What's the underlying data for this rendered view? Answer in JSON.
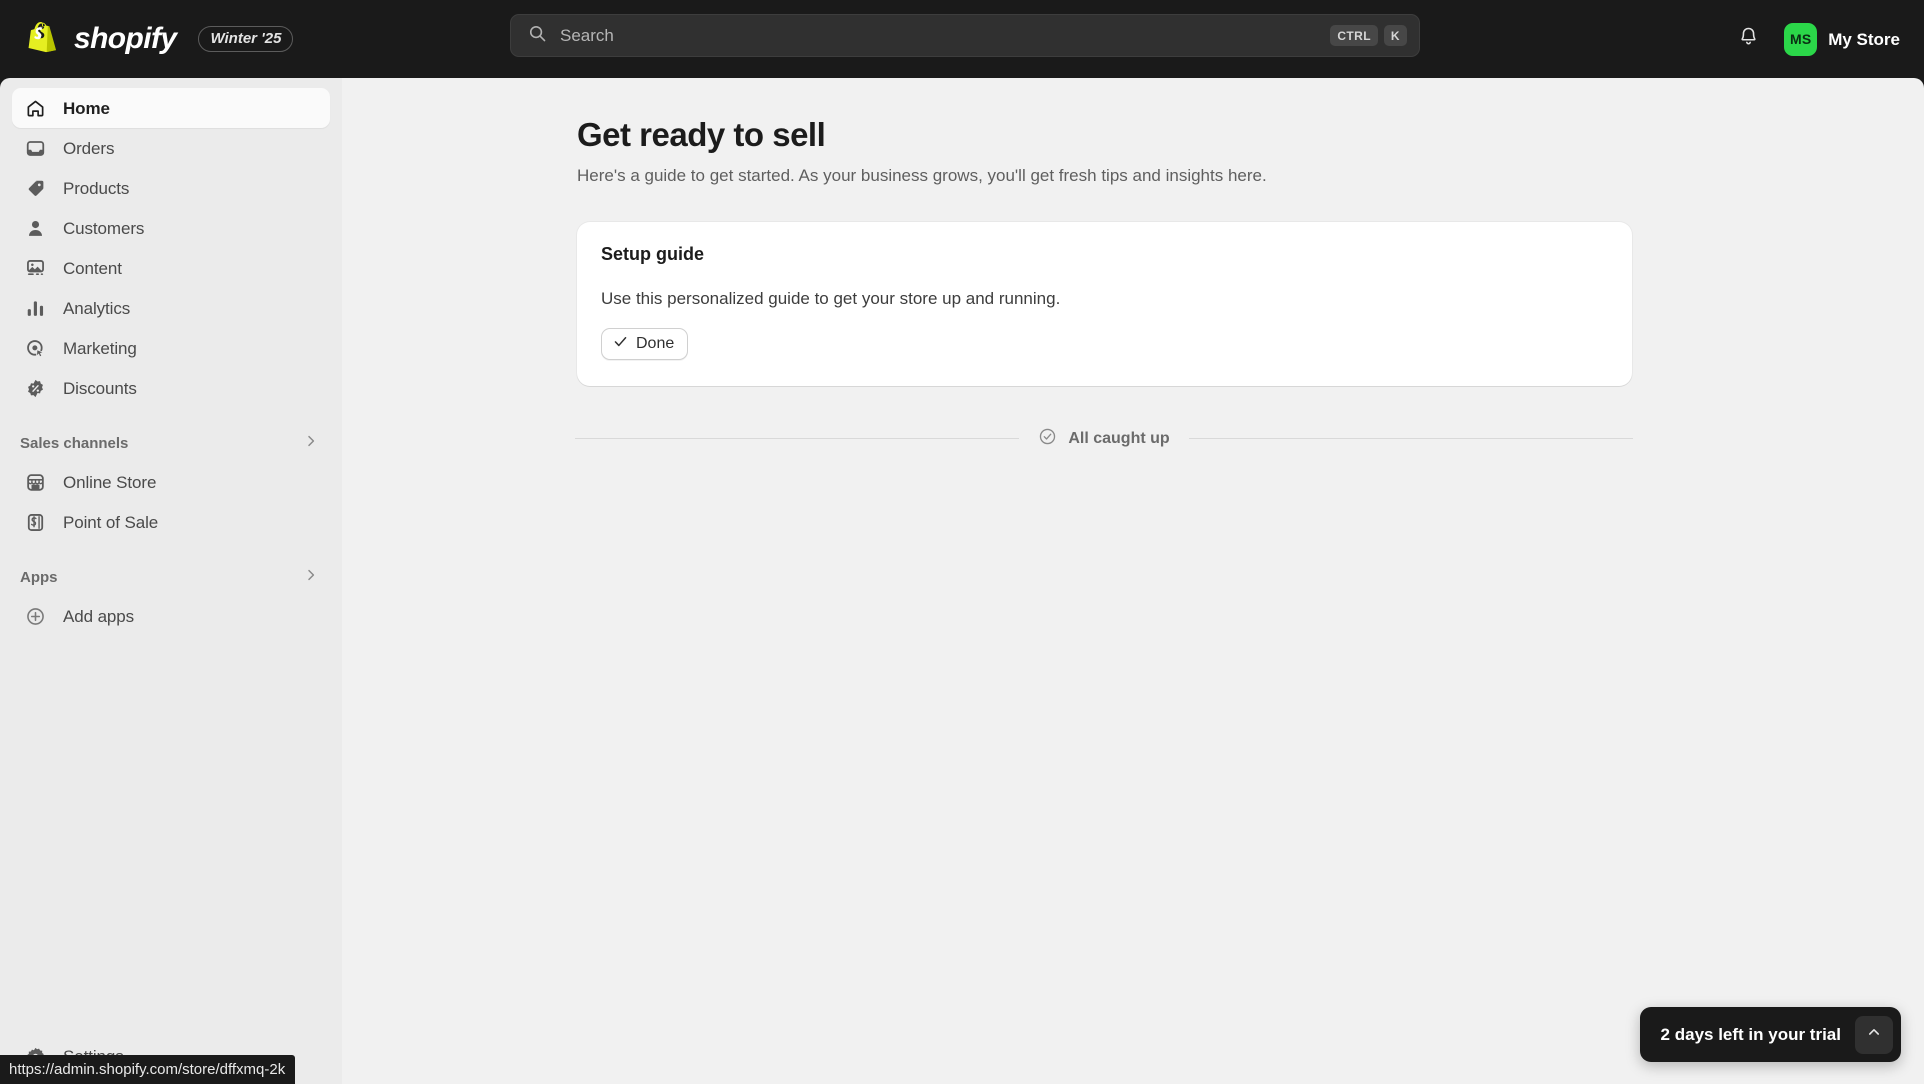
{
  "topbar": {
    "brand_name": "shopify",
    "version_badge": "Winter '25",
    "logo_icon": "shopify-bag-icon",
    "search": {
      "placeholder": "Search",
      "icon": "search-icon",
      "shortcut_modifier": "CTRL",
      "shortcut_key": "K"
    },
    "notifications_icon": "bell-icon",
    "account": {
      "avatar_initials": "MS",
      "store_name": "My Store",
      "avatar_color": "#2bd749"
    }
  },
  "sidebar": {
    "items": [
      {
        "label": "Home",
        "icon": "home-icon",
        "active": true
      },
      {
        "label": "Orders",
        "icon": "orders-inbox-icon",
        "active": false
      },
      {
        "label": "Products",
        "icon": "product-tag-icon",
        "active": false
      },
      {
        "label": "Customers",
        "icon": "person-icon",
        "active": false
      },
      {
        "label": "Content",
        "icon": "content-image-icon",
        "active": false
      },
      {
        "label": "Analytics",
        "icon": "bar-chart-icon",
        "active": false
      },
      {
        "label": "Marketing",
        "icon": "target-cursor-icon",
        "active": false
      },
      {
        "label": "Discounts",
        "icon": "discount-badge-icon",
        "active": false
      }
    ],
    "sections": [
      {
        "title": "Sales channels",
        "chevron_icon": "chevron-right-icon",
        "items": [
          {
            "label": "Online Store",
            "icon": "storefront-icon"
          },
          {
            "label": "Point of Sale",
            "icon": "pos-receipt-icon"
          }
        ]
      },
      {
        "title": "Apps",
        "chevron_icon": "chevron-right-icon",
        "items": [
          {
            "label": "Add apps",
            "icon": "plus-circle-icon"
          }
        ]
      }
    ],
    "settings": {
      "label": "Settings",
      "icon": "gear-icon"
    }
  },
  "main": {
    "page_title": "Get ready to sell",
    "page_subtitle": "Here's a guide to get started. As your business grows, you'll get fresh tips and insights here.",
    "setup_card": {
      "title": "Setup guide",
      "body": "Use this personalized guide to get your store up and running.",
      "action_label": "Done",
      "action_icon": "check-icon"
    },
    "caught_up": {
      "label": "All caught up",
      "icon": "check-circle-icon"
    }
  },
  "trial_banner": {
    "text": "2 days left in your trial",
    "toggle_icon": "chevron-up-icon"
  },
  "status_bar": {
    "url": "https://admin.shopify.com/store/dffxmq-2k"
  }
}
